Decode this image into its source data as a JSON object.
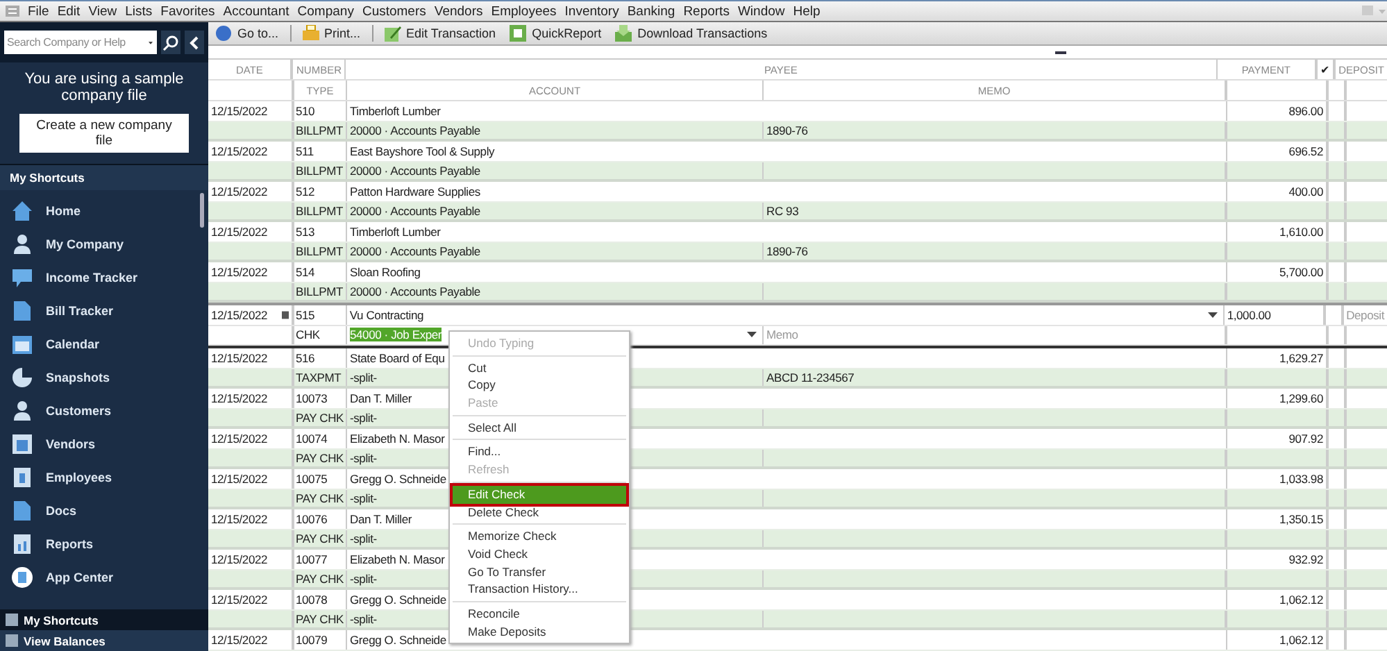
{
  "menu_bar": [
    "File",
    "Edit",
    "View",
    "Lists",
    "Favorites",
    "Accountant",
    "Company",
    "Customers",
    "Vendors",
    "Employees",
    "Inventory",
    "Banking",
    "Reports",
    "Window",
    "Help"
  ],
  "toolbar": [
    "Go to...",
    "Print...",
    "Edit Transaction",
    "QuickReport",
    "Download Transactions"
  ],
  "sidebar": {
    "search": {
      "placeholder": "Search Company or Help"
    },
    "notice": "You are using a sample company file",
    "create_button": "Create a new company file",
    "section_title": "My Shortcuts",
    "items": [
      "Home",
      "My Company",
      "Income Tracker",
      "Bill Tracker",
      "Calendar",
      "Snapshots",
      "Customers",
      "Vendors",
      "Employees",
      "Docs",
      "Reports",
      "App Center"
    ],
    "bottom_tabs": [
      {
        "label": "My Shortcuts",
        "selected": true
      },
      {
        "label": "View Balances",
        "selected": false
      }
    ]
  },
  "register": {
    "header_top": [
      "DATE",
      "NUMBER",
      "PAYEE",
      "PAYMENT",
      "✔",
      "DEPOSIT"
    ],
    "header_bottom": [
      "TYPE",
      "ACCOUNT",
      "MEMO"
    ],
    "transactions": [
      {
        "date": "12/15/2022",
        "number": "510",
        "payee": "Timberloft Lumber",
        "payment": "896.00",
        "type": "BILLPMT",
        "account": "20000 · Accounts Payable",
        "memo": "1890-76",
        "selected": false
      },
      {
        "date": "12/15/2022",
        "number": "511",
        "payee": "East Bayshore Tool & Supply",
        "payment": "696.52",
        "type": "BILLPMT",
        "account": "20000 · Accounts Payable",
        "selected": false
      },
      {
        "date": "12/15/2022",
        "number": "512",
        "payee": "Patton Hardware Supplies",
        "payment": "400.00",
        "type": "BILLPMT",
        "account": "20000 · Accounts Payable",
        "memo": "RC 93",
        "selected": false
      },
      {
        "date": "12/15/2022",
        "number": "513",
        "payee": "Timberloft Lumber",
        "payment": "1,610.00",
        "type": "BILLPMT",
        "account": "20000 · Accounts Payable",
        "memo": "1890-76",
        "selected": false
      },
      {
        "date": "12/15/2022",
        "number": "514",
        "payee": "Sloan Roofing",
        "payment": "5,700.00",
        "type": "BILLPMT",
        "account": "20000 · Accounts Payable",
        "selected": false
      },
      {
        "date": "12/15/2022",
        "number": "515",
        "payee": "Vu Contracting",
        "payment": "1,000.00",
        "deposit_placeholder": "Deposit",
        "type": "CHK",
        "account": "54000 · Job Exper",
        "memo_placeholder": "Memo",
        "selected": true
      },
      {
        "date": "12/15/2022",
        "number": "516",
        "payee": "State Board of Equ",
        "payment": "1,629.27",
        "type": "TAXPMT",
        "account": "-split-",
        "memo": "ABCD 11-234567",
        "selected": false
      },
      {
        "date": "12/15/2022",
        "number": "10073",
        "payee": "Dan T. Miller",
        "payment": "1,299.60",
        "type": "PAY CHK",
        "account": "-split-",
        "selected": false
      },
      {
        "date": "12/15/2022",
        "number": "10074",
        "payee": "Elizabeth N. Masor",
        "payment": "907.92",
        "type": "PAY CHK",
        "account": "-split-",
        "selected": false
      },
      {
        "date": "12/15/2022",
        "number": "10075",
        "payee": "Gregg O. Schneide",
        "payment": "1,033.98",
        "type": "PAY CHK",
        "account": "-split-",
        "selected": false
      },
      {
        "date": "12/15/2022",
        "number": "10076",
        "payee": "Dan T. Miller",
        "payment": "1,350.15",
        "type": "PAY CHK",
        "account": "-split-",
        "selected": false
      },
      {
        "date": "12/15/2022",
        "number": "10077",
        "payee": "Elizabeth N. Masor",
        "payment": "932.92",
        "type": "PAY CHK",
        "account": "-split-",
        "selected": false
      },
      {
        "date": "12/15/2022",
        "number": "10078",
        "payee": "Gregg O. Schneide",
        "payment": "1,062.12",
        "type": "PAY CHK",
        "account": "-split-",
        "selected": false
      },
      {
        "date": "12/15/2022",
        "number": "10079",
        "payee": "Gregg O. Schneide",
        "payment": "1,062.12",
        "selected": false
      }
    ]
  },
  "context_menu": {
    "groups": [
      [
        {
          "label": "Undo Typing",
          "disabled": true,
          "selected": false
        }
      ],
      [
        {
          "label": "Cut",
          "disabled": false,
          "selected": false
        },
        {
          "label": "Copy",
          "disabled": false,
          "selected": false
        },
        {
          "label": "Paste",
          "disabled": true,
          "selected": false
        }
      ],
      [
        {
          "label": "Select All",
          "disabled": false,
          "selected": false
        }
      ],
      [
        {
          "label": "Find...",
          "disabled": false,
          "selected": false
        },
        {
          "label": "Refresh",
          "disabled": true,
          "selected": false
        }
      ],
      [
        {
          "label": "Edit Check",
          "disabled": false,
          "selected": true
        },
        {
          "label": "Delete Check",
          "disabled": false,
          "selected": false
        }
      ],
      [
        {
          "label": "Memorize Check",
          "disabled": false,
          "selected": false
        },
        {
          "label": "Void Check",
          "disabled": false,
          "selected": false
        },
        {
          "label": "Go To Transfer",
          "disabled": false,
          "selected": false
        },
        {
          "label": "Transaction History...",
          "disabled": false,
          "selected": false
        }
      ],
      [
        {
          "label": "Reconcile",
          "disabled": false,
          "selected": false
        },
        {
          "label": "Make Deposits",
          "disabled": false,
          "selected": false
        }
      ]
    ]
  }
}
